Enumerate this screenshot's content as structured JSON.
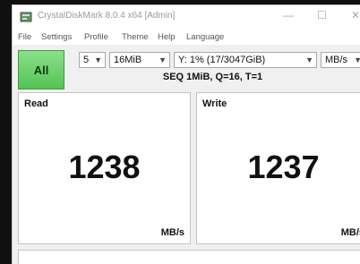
{
  "window": {
    "title": "CrystalDiskMark 8.0.4 x64 [Admin]",
    "controls": {
      "minimize": "—",
      "maximize": "☐",
      "close": "✕"
    }
  },
  "menu": [
    "File",
    "Settings",
    "Profile",
    "Theme",
    "Help",
    "Language"
  ],
  "toolbar": {
    "all_label": "All",
    "count_value": "5",
    "size_value": "16MiB",
    "drive_value": "Y: 1% (17/3047GiB)",
    "unit_value": "MB/s"
  },
  "test_label": "SEQ 1MiB, Q=16, T=1",
  "read": {
    "title": "Read",
    "value": "1238",
    "unit": "MB/s"
  },
  "write": {
    "title": "Write",
    "value": "1237",
    "unit": "MB/s"
  },
  "status_text": "",
  "colors": {
    "all_button": "#55c255",
    "background": "#101010",
    "window": "#f0f0f0"
  }
}
